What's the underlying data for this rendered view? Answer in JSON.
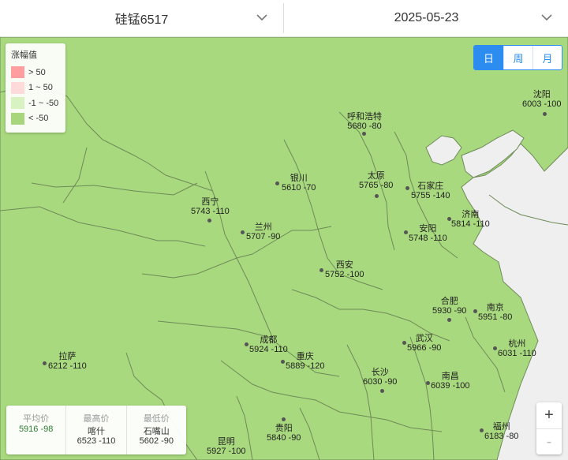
{
  "header": {
    "product": "硅锰6517",
    "date": "2025-05-23"
  },
  "legend": {
    "title": "涨幅值",
    "items": [
      {
        "label": "> 50",
        "color": "#ff9e9e"
      },
      {
        "label": "1 ~ 50",
        "color": "#ffdada"
      },
      {
        "label": "-1 ~ -50",
        "color": "#d9f2c2"
      },
      {
        "label": "< -50",
        "color": "#a7d67d"
      }
    ]
  },
  "period_tabs": [
    "日",
    "周",
    "月"
  ],
  "active_period": "日",
  "map": {
    "land_color": "#a8d97e",
    "sea_color": "#efefef",
    "border_color": "#6e8a58",
    "cities": [
      {
        "name": "沈阳",
        "value": "6003 -100"
      },
      {
        "name": "呼和浩特",
        "value": "5680 -80"
      },
      {
        "name": "银川",
        "value": "5610 -70"
      },
      {
        "name": "太原",
        "value": "5765 -80"
      },
      {
        "name": "石家庄",
        "value": "5755 -140"
      },
      {
        "name": "西宁",
        "value": "5743 -110"
      },
      {
        "name": "兰州",
        "value": "5707 -90"
      },
      {
        "name": "济南",
        "value": "5814 -110"
      },
      {
        "name": "安阳",
        "value": "5748 -110"
      },
      {
        "name": "西安",
        "value": "5752 -100"
      },
      {
        "name": "合肥",
        "value": "5930 -90"
      },
      {
        "name": "南京",
        "value": "5951 -80"
      },
      {
        "name": "成都",
        "value": "5924 -110"
      },
      {
        "name": "重庆",
        "value": "5889 -120"
      },
      {
        "name": "武汉",
        "value": "5966 -90"
      },
      {
        "name": "杭州",
        "value": "6031 -110"
      },
      {
        "name": "拉萨",
        "value": "6212 -110"
      },
      {
        "name": "长沙",
        "value": "6030 -90"
      },
      {
        "name": "南昌",
        "value": "6039 -100"
      },
      {
        "name": "贵阳",
        "value": "5840 -90"
      },
      {
        "name": "昆明",
        "value": "5927 -100"
      },
      {
        "name": "福州",
        "value": "6183 -80"
      }
    ]
  },
  "stats": {
    "avg": {
      "label": "平均价",
      "value": "5916 -98"
    },
    "max": {
      "label": "最高价",
      "city": "喀什",
      "value": "6523 -110"
    },
    "min": {
      "label": "最低价",
      "city": "石嘴山",
      "value": "5602 -90"
    }
  },
  "zoom": {
    "in": "+",
    "out": "-"
  }
}
